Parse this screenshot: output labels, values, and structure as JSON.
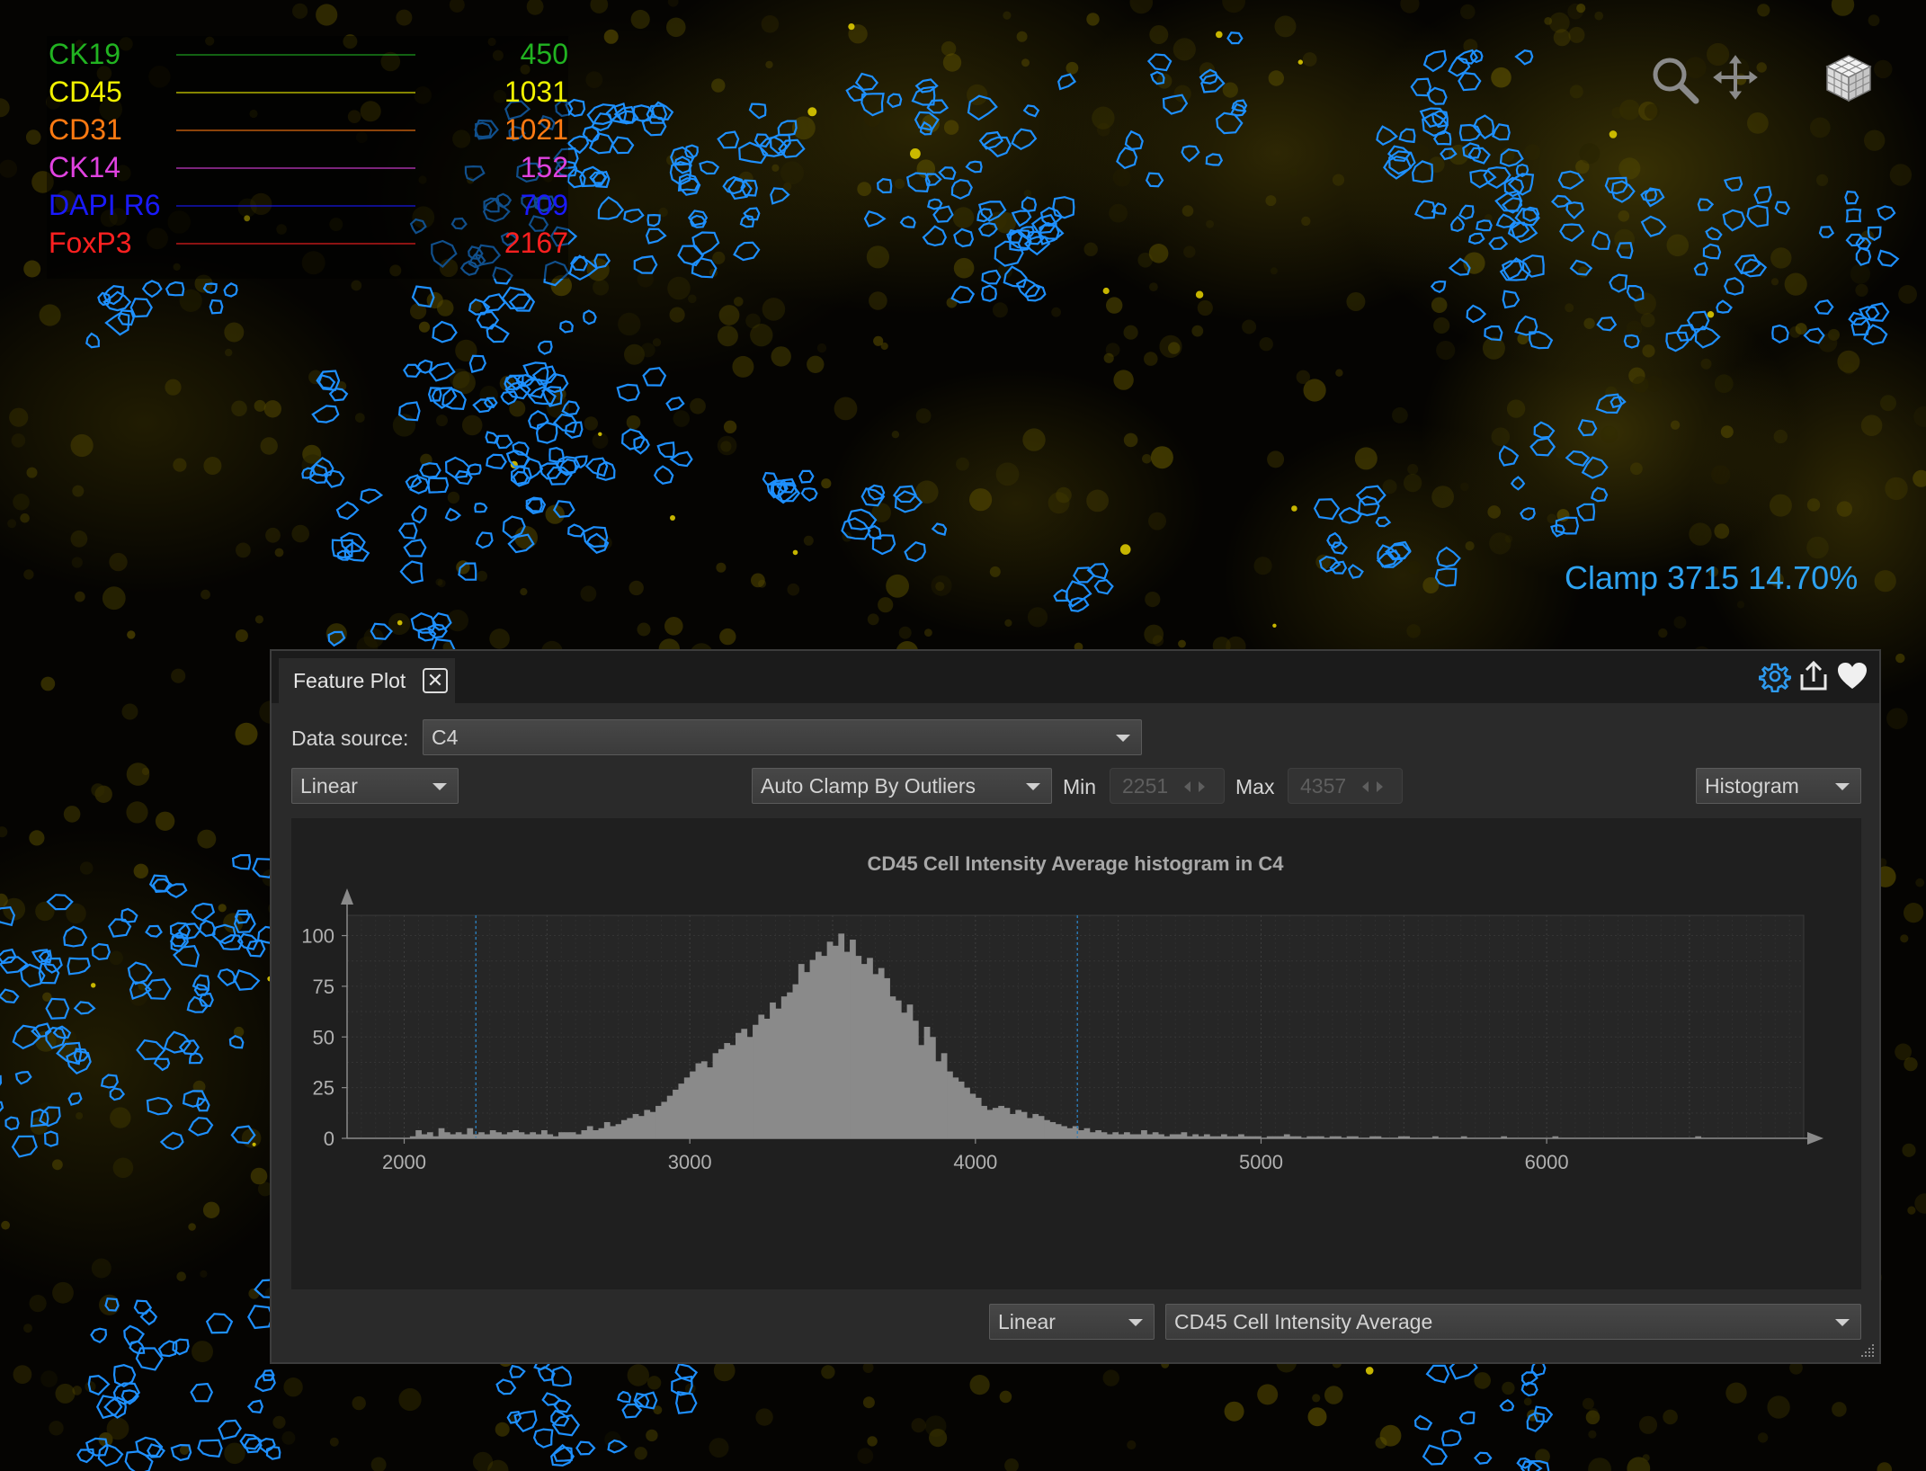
{
  "viewer": {
    "channels": [
      {
        "name": "CK19",
        "value": "450",
        "color": "#21b321"
      },
      {
        "name": "CD45",
        "value": "1031",
        "color": "#f2f200"
      },
      {
        "name": "CD31",
        "value": "1021",
        "color": "#ff7a12"
      },
      {
        "name": "CK14",
        "value": "152",
        "color": "#e042e0"
      },
      {
        "name": "DAPI R6",
        "value": "709",
        "color": "#1a1aff"
      },
      {
        "name": "FoxP3",
        "value": "2167",
        "color": "#ff2020"
      }
    ],
    "clamp_readout": "Clamp 3715 14.70%",
    "outline_color": "#1e90ff",
    "tools": [
      "zoom-icon",
      "pan-icon",
      "cube-icon"
    ]
  },
  "panel": {
    "tab_label": "Feature Plot",
    "header_icons": [
      "gear-icon",
      "export-icon",
      "heart-icon"
    ],
    "data_source_label": "Data source:",
    "data_source_value": "C4",
    "scale_mode": "Linear",
    "clamp_mode": "Auto Clamp By Outliers",
    "min_label": "Min",
    "min_value": "2251",
    "max_label": "Max",
    "max_value": "4357",
    "plot_type": "Histogram",
    "x_scale": "Linear",
    "feature": "CD45 Cell Intensity Average"
  },
  "chart_data": {
    "type": "bar",
    "title": "CD45 Cell Intensity Average histogram in C4",
    "xlabel": "",
    "ylabel": "",
    "xlim": [
      1800,
      6900
    ],
    "ylim": [
      0,
      110
    ],
    "xticks": [
      2000,
      3000,
      4000,
      5000,
      6000
    ],
    "yticks": [
      0,
      25,
      50,
      75,
      100
    ],
    "clamp_lines": [
      2251,
      4357
    ],
    "bin_width": 20,
    "bins_start": 2020,
    "values": [
      1,
      4,
      2,
      3,
      1,
      5,
      3,
      2,
      3,
      2,
      5,
      2,
      3,
      2,
      4,
      3,
      2,
      3,
      4,
      3,
      2,
      3,
      2,
      4,
      2,
      1,
      3,
      3,
      3,
      2,
      4,
      6,
      4,
      5,
      8,
      6,
      7,
      9,
      10,
      12,
      11,
      14,
      13,
      16,
      18,
      21,
      24,
      27,
      30,
      33,
      37,
      38,
      35,
      42,
      44,
      47,
      46,
      52,
      54,
      50,
      56,
      61,
      59,
      67,
      64,
      70,
      72,
      76,
      86,
      82,
      88,
      92,
      90,
      97,
      95,
      101,
      92,
      98,
      90,
      86,
      89,
      81,
      84,
      79,
      70,
      68,
      62,
      66,
      58,
      46,
      55,
      50,
      38,
      42,
      33,
      30,
      28,
      25,
      22,
      20,
      16,
      14,
      15,
      16,
      15,
      12,
      14,
      13,
      10,
      12,
      11,
      9,
      8,
      7,
      6,
      5,
      6,
      4,
      5,
      3,
      4,
      3,
      2,
      3,
      2,
      3,
      2,
      2,
      4,
      2,
      3,
      2,
      1,
      2,
      2,
      3,
      1,
      2,
      1,
      2,
      1,
      1,
      2,
      1,
      1,
      2,
      1,
      1,
      1,
      0,
      1,
      1,
      1,
      2,
      1,
      1,
      0,
      1,
      1,
      1,
      0,
      1,
      1,
      0,
      1,
      1,
      0,
      0,
      1,
      1,
      0,
      0,
      0,
      1,
      1,
      0,
      0,
      0,
      0,
      1,
      0,
      0,
      0,
      0,
      1,
      0,
      0,
      0,
      0,
      0,
      0,
      1,
      0,
      0,
      0,
      0,
      0,
      0,
      0,
      0,
      1,
      0,
      0,
      0,
      0,
      0,
      0,
      0,
      0,
      0,
      0,
      0,
      0,
      0,
      0,
      0,
      0,
      0,
      0,
      0,
      0,
      0,
      0,
      0,
      0,
      1,
      0,
      0,
      0,
      0,
      0,
      0,
      0,
      0,
      0,
      0,
      0,
      0,
      0,
      0,
      0,
      0,
      0,
      0,
      0,
      0,
      0,
      0,
      0,
      0,
      0,
      0,
      0,
      0,
      0,
      0,
      0,
      0,
      0,
      0,
      0,
      0,
      0,
      0,
      0,
      0,
      0,
      0,
      1,
      1,
      0,
      0,
      0,
      0,
      0,
      0,
      0,
      0,
      0,
      0,
      0,
      0,
      0,
      0,
      0,
      0,
      0,
      0,
      0,
      0,
      0,
      0,
      0,
      0,
      0,
      0,
      0,
      0,
      0,
      0,
      0,
      1
    ],
    "bar_color": "#8a8a8a",
    "grid": true
  }
}
